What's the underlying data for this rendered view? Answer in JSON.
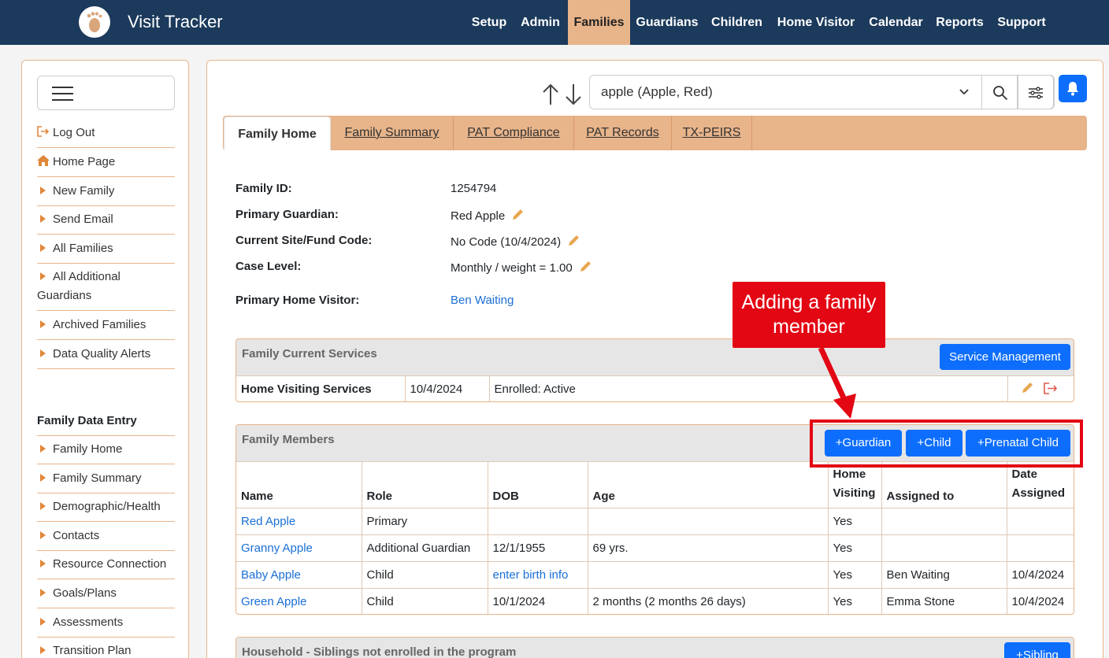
{
  "app": {
    "title": "Visit Tracker"
  },
  "nav": {
    "items": [
      {
        "label": "Setup"
      },
      {
        "label": "Admin"
      },
      {
        "label": "Families"
      },
      {
        "label": "Guardians"
      },
      {
        "label": "Children"
      },
      {
        "label": "Home Visitor"
      },
      {
        "label": "Calendar"
      },
      {
        "label": "Reports"
      },
      {
        "label": "Support"
      }
    ],
    "active": "Families"
  },
  "sidebar": {
    "items": [
      {
        "label": "Log Out",
        "icon": "logout-icon"
      },
      {
        "label": "Home Page",
        "icon": "home-icon"
      },
      {
        "label": "New Family"
      },
      {
        "label": "Send Email"
      },
      {
        "label": "All Families"
      },
      {
        "label": "All Additional Guardians"
      },
      {
        "label": "Archived Families"
      },
      {
        "label": "Data Quality Alerts"
      }
    ],
    "section_title": "Family Data Entry",
    "section_items": [
      {
        "label": "Family Home"
      },
      {
        "label": "Family Summary"
      },
      {
        "label": "Demographic/Health"
      },
      {
        "label": "Contacts"
      },
      {
        "label": "Resource Connection"
      },
      {
        "label": "Goals/Plans"
      },
      {
        "label": "Assessments"
      },
      {
        "label": "Transition Plan"
      }
    ]
  },
  "search": {
    "value": "apple (Apple, Red)"
  },
  "tabs": [
    {
      "label": "Family Home"
    },
    {
      "label": "Family Summary"
    },
    {
      "label": "PAT Compliance"
    },
    {
      "label": "PAT Records"
    },
    {
      "label": "TX-PEIRS"
    }
  ],
  "family": {
    "id_label": "Family ID:",
    "id_value": "1254794",
    "guardian_label": "Primary Guardian:",
    "guardian_value": "Red Apple",
    "site_label": "Current Site/Fund Code:",
    "site_value": "No Code (10/4/2024)",
    "case_label": "Case Level:",
    "case_value": "Monthly / weight = 1.00",
    "visitor_label": "Primary Home Visitor:",
    "visitor_value": "Ben Waiting"
  },
  "services": {
    "title": "Family Current Services",
    "button": "Service Management",
    "row": {
      "name": "Home Visiting Services",
      "date": "10/4/2024",
      "status": "Enrolled: Active"
    }
  },
  "members": {
    "title": "Family Members",
    "buttons": [
      "+Guardian",
      "+Child",
      "+Prenatal Child"
    ],
    "columns": [
      "Name",
      "Role",
      "DOB",
      "Age",
      "Home Visiting",
      "Assigned to",
      "Date Assigned"
    ],
    "rows": [
      {
        "name": "Red Apple",
        "role": "Primary",
        "dob": "",
        "age": "",
        "hv": "Yes",
        "assigned": "",
        "date": ""
      },
      {
        "name": "Granny Apple",
        "role": "Additional Guardian",
        "dob": "12/1/1955",
        "age": "69 yrs.",
        "hv": "Yes",
        "assigned": "",
        "date": ""
      },
      {
        "name": "Baby Apple",
        "role": "Child",
        "dob": "enter birth info",
        "age": "",
        "hv": "Yes",
        "assigned": "Ben Waiting",
        "date": "10/4/2024"
      },
      {
        "name": "Green Apple",
        "role": "Child",
        "dob": "10/1/2024",
        "age": "2 months (2 months 26 days)",
        "hv": "Yes",
        "assigned": "Emma Stone",
        "date": "10/4/2024"
      }
    ]
  },
  "household": {
    "title": "Household - Siblings not enrolled in the program",
    "button": "+Sibling"
  },
  "annotation": {
    "text": "Adding a family member"
  },
  "colors": {
    "navbar": "#1b3a5c",
    "accent": "#e8b48a",
    "primary": "#0d6efd",
    "annotation": "#e30613"
  }
}
